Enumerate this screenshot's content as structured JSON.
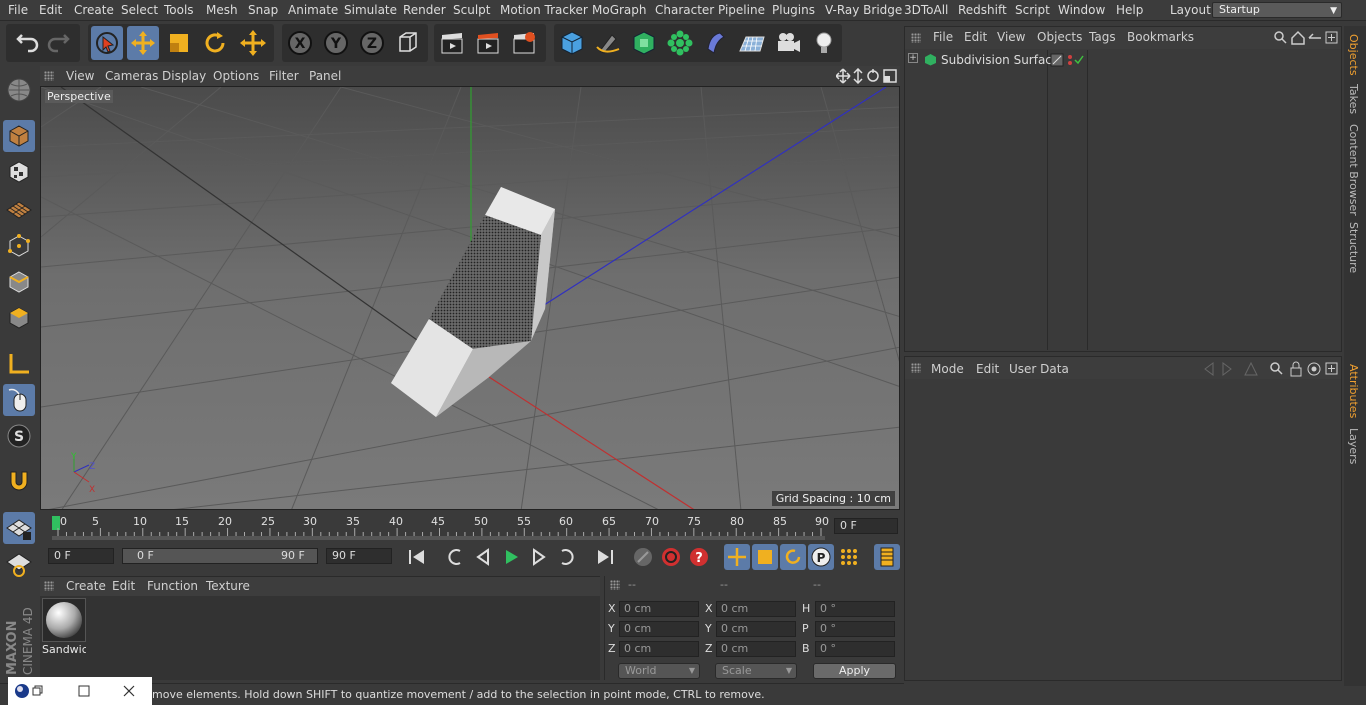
{
  "menubar": {
    "items": [
      "File",
      "Edit",
      "Create",
      "Select",
      "Tools",
      "Mesh",
      "Snap",
      "Animate",
      "Simulate",
      "Render",
      "Sculpt",
      "Motion Tracker",
      "MoGraph",
      "Character",
      "Pipeline",
      "Plugins",
      "V-Ray Bridge",
      "3DToAll",
      "Redshift",
      "Script",
      "Window",
      "Help"
    ],
    "layout_label": "Layout:",
    "layout_value": "Startup"
  },
  "viewport": {
    "menu": [
      "View",
      "Cameras",
      "Display",
      "Options",
      "Filter",
      "Panel"
    ],
    "camera_label": "Perspective",
    "grid_spacing": "Grid Spacing : 10 cm",
    "axis_labels": {
      "x": "X",
      "y": "Y",
      "z": "Z"
    }
  },
  "timeline": {
    "ticks": [
      "0",
      "5",
      "10",
      "15",
      "20",
      "25",
      "30",
      "35",
      "40",
      "45",
      "50",
      "55",
      "60",
      "65",
      "70",
      "75",
      "80",
      "85",
      "90"
    ],
    "current_frame": "0 F"
  },
  "transport": {
    "start_field": "0 F",
    "range_start": "0 F",
    "range_end": "90 F",
    "end_field": "90 F"
  },
  "material_manager": {
    "menu": [
      "Create",
      "Edit",
      "Function",
      "Texture"
    ],
    "material_name": "Sandwich"
  },
  "coordinates": {
    "headers": [
      "--",
      "--",
      "--"
    ],
    "rows": [
      {
        "l1": "X",
        "v1": "0 cm",
        "l2": "X",
        "v2": "0 cm",
        "l3": "H",
        "v3": "0 °"
      },
      {
        "l1": "Y",
        "v1": "0 cm",
        "l2": "Y",
        "v2": "0 cm",
        "l3": "P",
        "v3": "0 °"
      },
      {
        "l1": "Z",
        "v1": "0 cm",
        "l2": "Z",
        "v2": "0 cm",
        "l3": "B",
        "v3": "0 °"
      }
    ],
    "space_dropdown": "World",
    "mode_dropdown": "Scale",
    "apply_label": "Apply"
  },
  "status": {
    "text": "Move: Click and drag to move elements. Hold down SHIFT to quantize movement / add to the selection in point mode, CTRL to remove.",
    "visible_text": "move elements. Hold down SHIFT to quantize movement / add to the selection in point mode, CTRL to remove."
  },
  "object_manager": {
    "menu": [
      "File",
      "Edit",
      "View",
      "Objects",
      "Tags",
      "Bookmarks"
    ],
    "objects": [
      {
        "name": "Subdivision Surface"
      }
    ]
  },
  "attribute_manager": {
    "menu": [
      "Mode",
      "Edit",
      "User Data"
    ]
  },
  "side_tabs": [
    "Objects",
    "Takes",
    "Content Browser",
    "Structure"
  ],
  "side_tabs_lower": [
    "Attributes",
    "Layers"
  ],
  "colors": {
    "selected_tool": "#5c7ba8",
    "active_tab": "#f0a030",
    "axis_x": "#c03030",
    "axis_y": "#30a030",
    "axis_z": "#3030c0"
  }
}
